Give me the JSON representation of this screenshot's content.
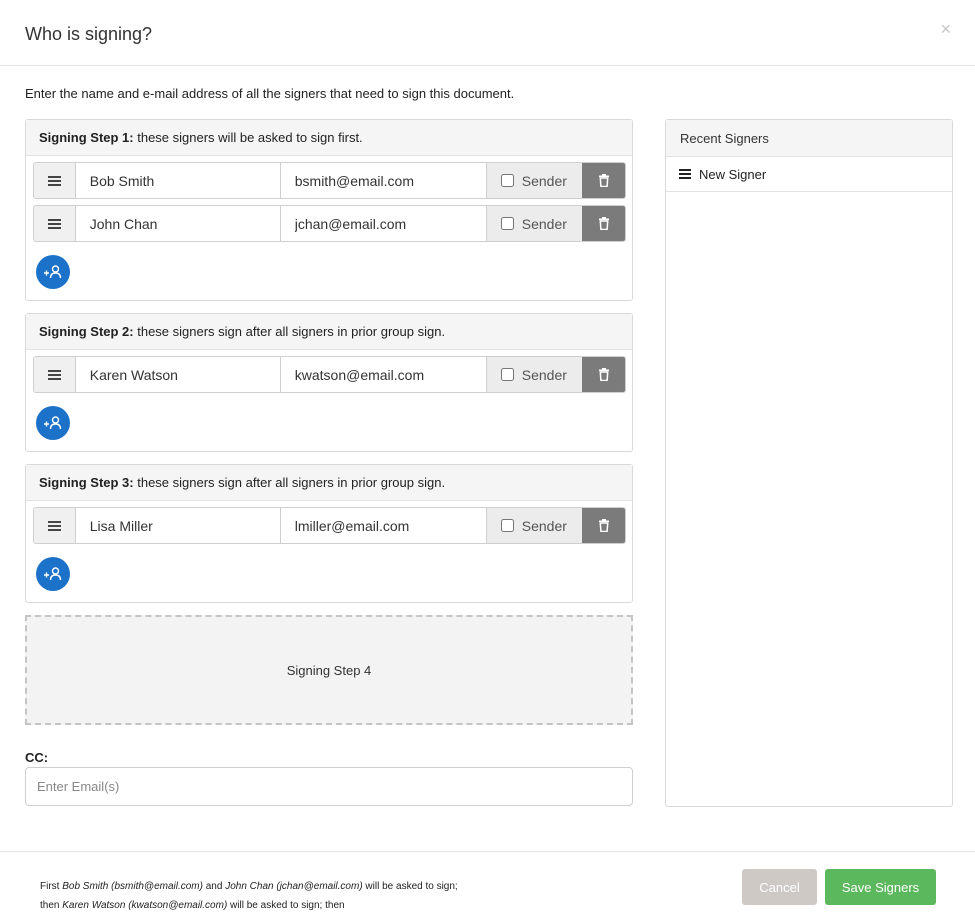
{
  "modal": {
    "title": "Who is signing?",
    "close_symbol": "×",
    "intro": "Enter the name and e-mail address of all the signers that need to sign this document."
  },
  "steps": [
    {
      "label": "Signing Step 1:",
      "description": " these signers will be asked to sign first.",
      "signers": [
        {
          "name": "Bob Smith",
          "email": "bsmith@email.com",
          "sender_label": "Sender",
          "sender_checked": false
        },
        {
          "name": "John Chan",
          "email": "jchan@email.com",
          "sender_label": "Sender",
          "sender_checked": false
        }
      ]
    },
    {
      "label": "Signing Step 2:",
      "description": " these signers sign after all signers in prior group sign.",
      "signers": [
        {
          "name": "Karen Watson",
          "email": "kwatson@email.com",
          "sender_label": "Sender",
          "sender_checked": false
        }
      ]
    },
    {
      "label": "Signing Step 3:",
      "description": " these signers sign after all signers in prior group sign.",
      "signers": [
        {
          "name": "Lisa Miller",
          "email": "lmiller@email.com",
          "sender_label": "Sender",
          "sender_checked": false
        }
      ]
    }
  ],
  "dropzone": {
    "label": "Signing Step 4"
  },
  "cc": {
    "label": "CC:",
    "placeholder": "Enter Email(s)",
    "value": ""
  },
  "recent_signers": {
    "title": "Recent Signers",
    "items": [
      {
        "label": "New Signer"
      }
    ]
  },
  "summary": {
    "line1_prefix": "First ",
    "line1_signer1": "Bob Smith (bsmith@email.com)",
    "line1_and": " and ",
    "line1_signer2": "John Chan (jchan@email.com)",
    "line1_suffix": " will be asked to sign;",
    "line2_prefix": "then ",
    "line2_signer": "Karen Watson (kwatson@email.com)",
    "line2_suffix": " will be asked to sign; then"
  },
  "buttons": {
    "cancel": "Cancel",
    "save": "Save Signers"
  },
  "colors": {
    "add_button": "#1b72c8",
    "trash_button": "#7b7b7b",
    "save_button": "#5cb85c",
    "cancel_button": "#cfc9c6"
  },
  "icons": {
    "drag": "hamburger-icon",
    "delete": "trash-icon",
    "add_signer": "add-user-icon",
    "close": "close-icon"
  }
}
